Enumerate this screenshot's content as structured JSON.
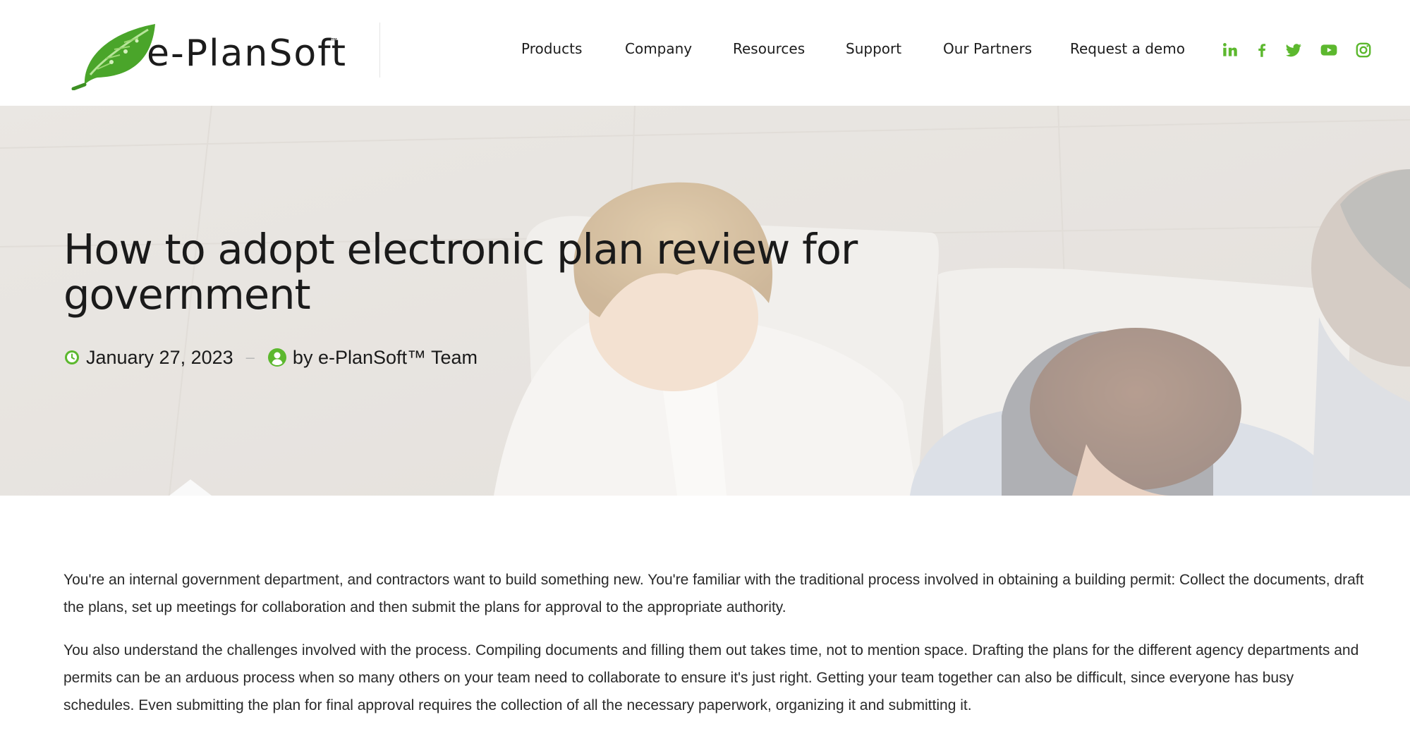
{
  "brand": {
    "name": "e-PlanSoft",
    "trademark": "™",
    "accent_color": "#5cb82e"
  },
  "nav": {
    "items": [
      {
        "label": "Products"
      },
      {
        "label": "Company"
      },
      {
        "label": "Resources"
      },
      {
        "label": "Support"
      },
      {
        "label": "Our Partners"
      },
      {
        "label": "Request a demo"
      }
    ]
  },
  "social": [
    {
      "icon": "linkedin-icon"
    },
    {
      "icon": "facebook-icon"
    },
    {
      "icon": "twitter-icon"
    },
    {
      "icon": "youtube-icon"
    },
    {
      "icon": "instagram-icon"
    }
  ],
  "hero": {
    "title": "How to adopt electronic plan review for government",
    "date": "January 27, 2023",
    "separator": "–",
    "author": "by e-PlanSoft™ Team",
    "date_icon": "clock-icon",
    "author_icon": "user-icon"
  },
  "article": {
    "paragraphs": [
      "You're an internal government department, and contractors want to build something new. You're familiar with the traditional process involved in obtaining a building permit: Collect the documents, draft the plans, set up meetings for collaboration and then submit the plans for approval to the appropriate authority.",
      "You also understand the challenges involved with the process. Compiling documents and filling them out takes time, not to mention space. Drafting the plans for the different agency departments and permits can be an arduous process when so many others on your team need to collaborate to ensure it's just right. Getting your team together can also be difficult, since everyone has busy schedules. Even submitting the plan for final approval requires the collection of all the necessary paperwork, organizing it and submitting it."
    ]
  }
}
